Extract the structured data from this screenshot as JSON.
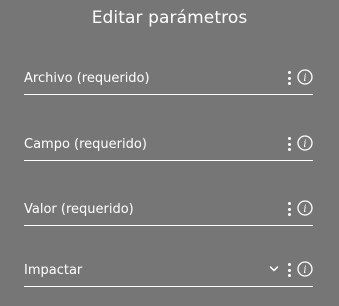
{
  "dialog": {
    "title": "Editar parámetros"
  },
  "fields": [
    {
      "label": "Archivo (requerido)",
      "type": "text",
      "icons": [
        "more-vertical-icon",
        "info-icon"
      ]
    },
    {
      "label": "Campo (requerido)",
      "type": "text",
      "icons": [
        "more-vertical-icon",
        "info-icon"
      ]
    },
    {
      "label": "Valor (requerido)",
      "type": "text",
      "icons": [
        "more-vertical-icon",
        "info-icon"
      ]
    },
    {
      "label": "Impactar",
      "type": "select",
      "icons": [
        "chevron-down-icon",
        "more-vertical-icon",
        "info-icon"
      ]
    }
  ],
  "colors": {
    "background": "#767676",
    "text": "#ffffff",
    "underline": "#ffffff"
  }
}
